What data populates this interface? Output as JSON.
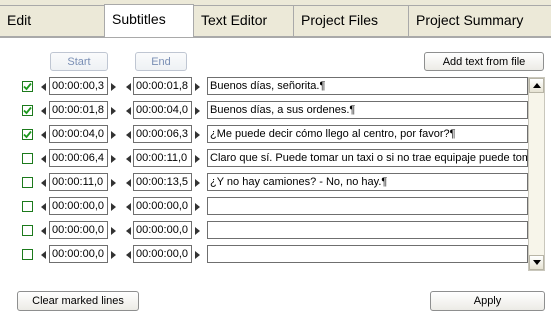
{
  "tabs": [
    {
      "label": "Edit"
    },
    {
      "label": "Subtitles"
    },
    {
      "label": "Text Editor"
    },
    {
      "label": "Project Files"
    },
    {
      "label": "Project Summary"
    }
  ],
  "active_tab": "Subtitles",
  "buttons": {
    "start": "Start",
    "end": "End",
    "add_text": "Add text from file",
    "clear_marked": "Clear marked lines",
    "apply": "Apply"
  },
  "rows": [
    {
      "checked": true,
      "start": "00:00:00,3",
      "end": "00:00:01,8",
      "text": "Buenos días, señorita.¶"
    },
    {
      "checked": true,
      "start": "00:00:01,8",
      "end": "00:00:04,0",
      "text": "Buenos días, a sus ordenes.¶"
    },
    {
      "checked": true,
      "start": "00:00:04,0",
      "end": "00:00:06,3",
      "text": "¿Me puede decir cómo llego al centro, por favor?¶"
    },
    {
      "checked": false,
      "start": "00:00:06,4",
      "end": "00:00:11,0",
      "text": "Claro que sí. Puede tomar un taxi o si no trae equipaje puede tom"
    },
    {
      "checked": false,
      "start": "00:00:11,0",
      "end": "00:00:13,5",
      "text": "¿Y no hay camiones? - No, no hay.¶"
    },
    {
      "checked": false,
      "start": "00:00:00,0",
      "end": "00:00:00,0",
      "text": ""
    },
    {
      "checked": false,
      "start": "00:00:00,0",
      "end": "00:00:00,0",
      "text": ""
    },
    {
      "checked": false,
      "start": "00:00:00,0",
      "end": "00:00:00,0",
      "text": ""
    }
  ],
  "colors": {
    "checkbox_border": "#1c7a1c",
    "checkmark": "#1c9a1c",
    "tab_background": "#ece9d8"
  }
}
